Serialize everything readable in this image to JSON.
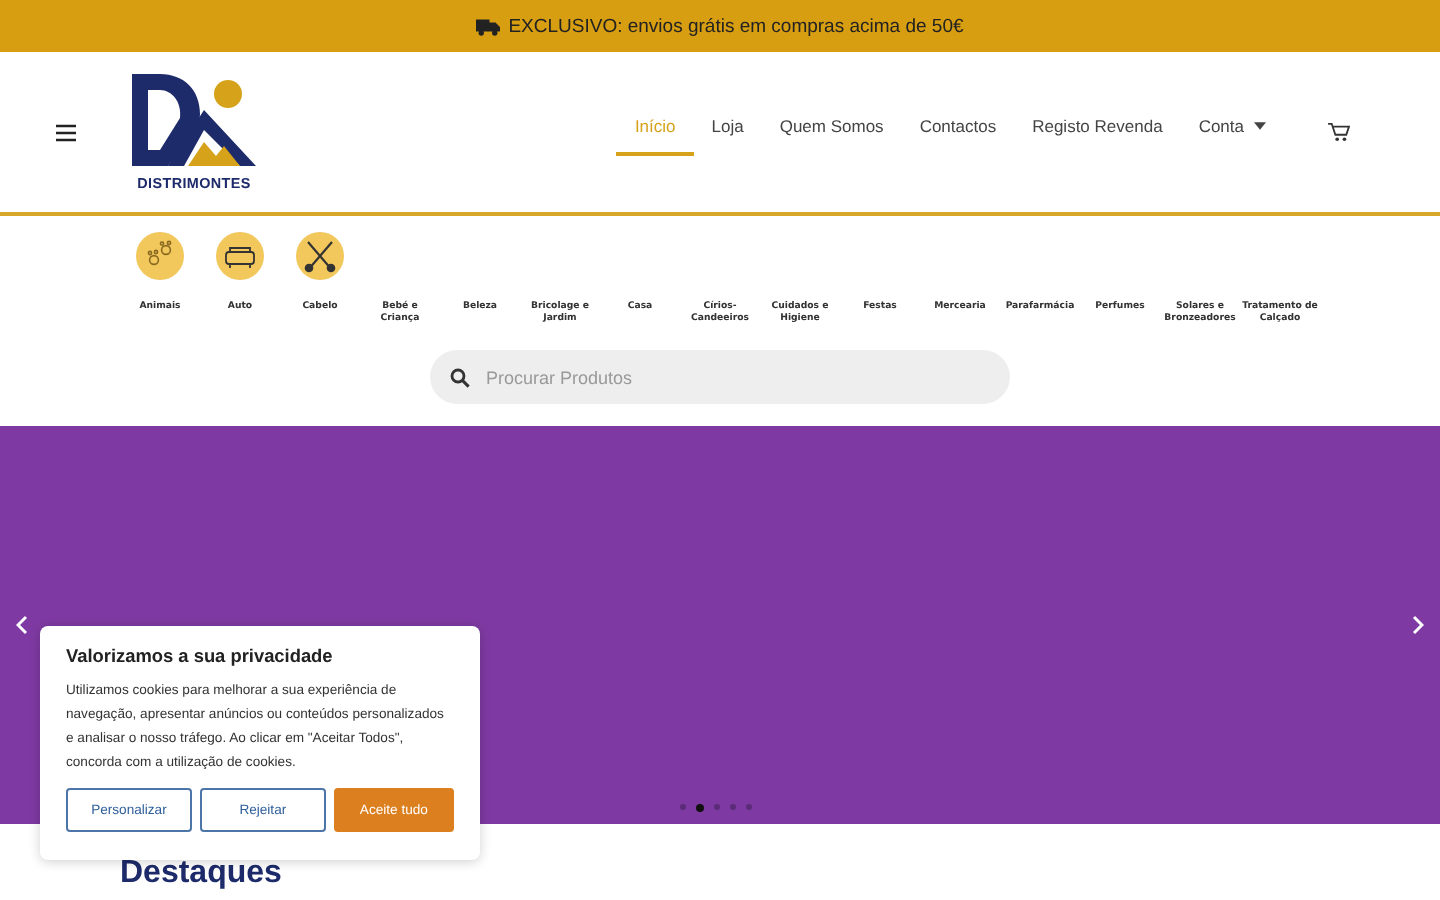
{
  "promo_bar": {
    "text": "EXCLUSIVO: envios grátis em compras acima de 50€"
  },
  "header": {
    "logo_text": "DISTRIMONTES",
    "nav": [
      {
        "label": "Início",
        "selected": true
      },
      {
        "label": "Loja",
        "selected": false
      },
      {
        "label": "Quem Somos",
        "selected": false
      },
      {
        "label": "Contactos",
        "selected": false
      },
      {
        "label": "Registo Revenda",
        "selected": false
      },
      {
        "label": "Conta",
        "selected": false,
        "kind": "dropdown"
      }
    ]
  },
  "categories": [
    {
      "label": "Animais",
      "kind": "icon"
    },
    {
      "label": "Auto",
      "kind": "icon"
    },
    {
      "label": "Cabelo",
      "kind": "icon"
    },
    {
      "label": "Bebé e Criança",
      "kind": "plain"
    },
    {
      "label": "Beleza",
      "kind": "plain"
    },
    {
      "label": "Bricolage e Jardim",
      "kind": "plain"
    },
    {
      "label": "Casa",
      "kind": "plain"
    },
    {
      "label": "Círios-Candeeiros",
      "kind": "plain"
    },
    {
      "label": "Cuidados e Higiene",
      "kind": "plain"
    },
    {
      "label": "Festas",
      "kind": "plain"
    },
    {
      "label": "Mercearia",
      "kind": "plain"
    },
    {
      "label": "Parafarmácia",
      "kind": "plain"
    },
    {
      "label": "Perfumes",
      "kind": "plain"
    },
    {
      "label": "Solares e Bronzeadores",
      "kind": "plain"
    },
    {
      "label": "Tratamento de Calçado",
      "kind": "plain"
    }
  ],
  "search": {
    "placeholder": "Procurar Produtos"
  },
  "hero": {
    "dots": [
      {
        "selected": false
      },
      {
        "selected": true
      },
      {
        "selected": false
      },
      {
        "selected": false
      },
      {
        "selected": false
      }
    ]
  },
  "cookie_banner": {
    "title": "Valorizamos a sua privacidade",
    "text": "Utilizamos cookies para melhorar a sua experiência de navegação, apresentar anúncios ou conteúdos personalizados e analisar o nosso tráfego. Ao clicar em \"Aceitar Todos\", concorda com a utilização de cookies.",
    "buttons": [
      {
        "label": "Personalizar",
        "kind": "outline"
      },
      {
        "label": "Rejeitar",
        "kind": "outline"
      },
      {
        "label": "Aceite tudo",
        "kind": "primary"
      }
    ]
  },
  "section_heading": "Destaques"
}
